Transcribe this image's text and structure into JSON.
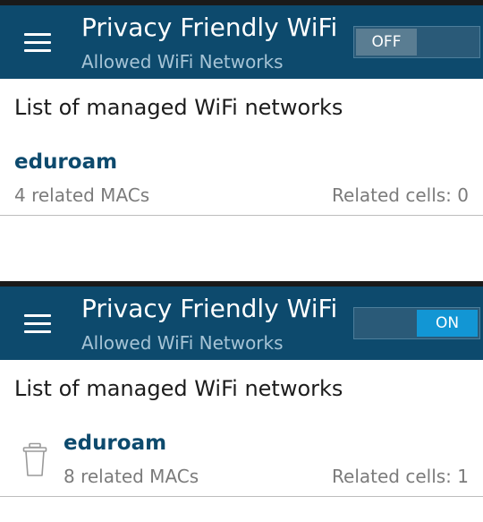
{
  "screens": [
    {
      "app_title": "Privacy Friendly WiFi",
      "subtitle": "Allowed WiFi Networks",
      "toggle_label": "OFF",
      "toggle_state": "off",
      "heading": "List of managed WiFi networks",
      "network": {
        "name": "eduroam",
        "macs": "4 related MACs",
        "cells": "Related cells: 0"
      }
    },
    {
      "app_title": "Privacy Friendly WiFi",
      "subtitle": "Allowed WiFi Networks",
      "toggle_label": "ON",
      "toggle_state": "on",
      "heading": "List of managed WiFi networks",
      "network": {
        "name": "eduroam",
        "macs": "8 related MACs",
        "cells": "Related cells: 1",
        "icon": "trash-icon"
      }
    }
  ],
  "colors": {
    "appbar": "#0d4a6d",
    "toggle_on": "#1296d4",
    "network_name": "#0d4a6d"
  }
}
